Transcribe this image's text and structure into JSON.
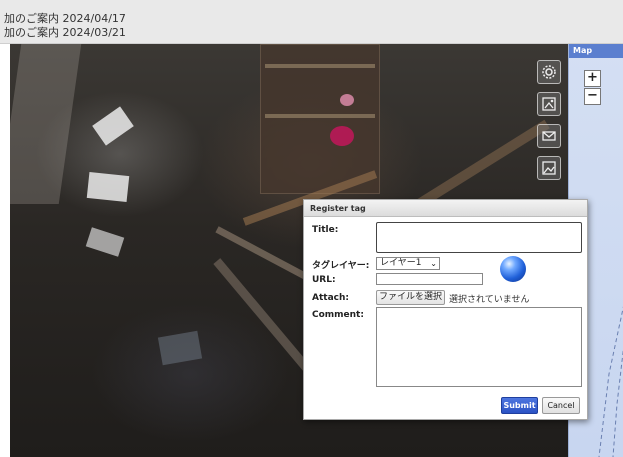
{
  "announcements": [
    {
      "text": "加のご案内 2024/04/17"
    },
    {
      "text": "加のご案内 2024/03/21"
    }
  ],
  "viewer": {
    "tool_icons": [
      "settings-cog-icon",
      "photo-edit-icon",
      "mail-icon",
      "image-icon"
    ]
  },
  "map": {
    "title": "Map",
    "zoom_in_label": "+",
    "zoom_out_label": "−"
  },
  "dialog": {
    "title": "Register tag",
    "title_label": "Title:",
    "layer_label": "タグレイヤー:",
    "layer_selected": "レイヤー1",
    "url_label": "URL:",
    "attach_label": "Attach:",
    "file_button_label": "ファイルを選択",
    "file_status": "選択されていません",
    "comment_label": "Comment:",
    "submit_label": "Submit",
    "cancel_label": "Cancel"
  },
  "colors": {
    "submit": "#2b52c4",
    "map_header": "#5b7fcf",
    "map_bg": "#c8d6f0"
  }
}
